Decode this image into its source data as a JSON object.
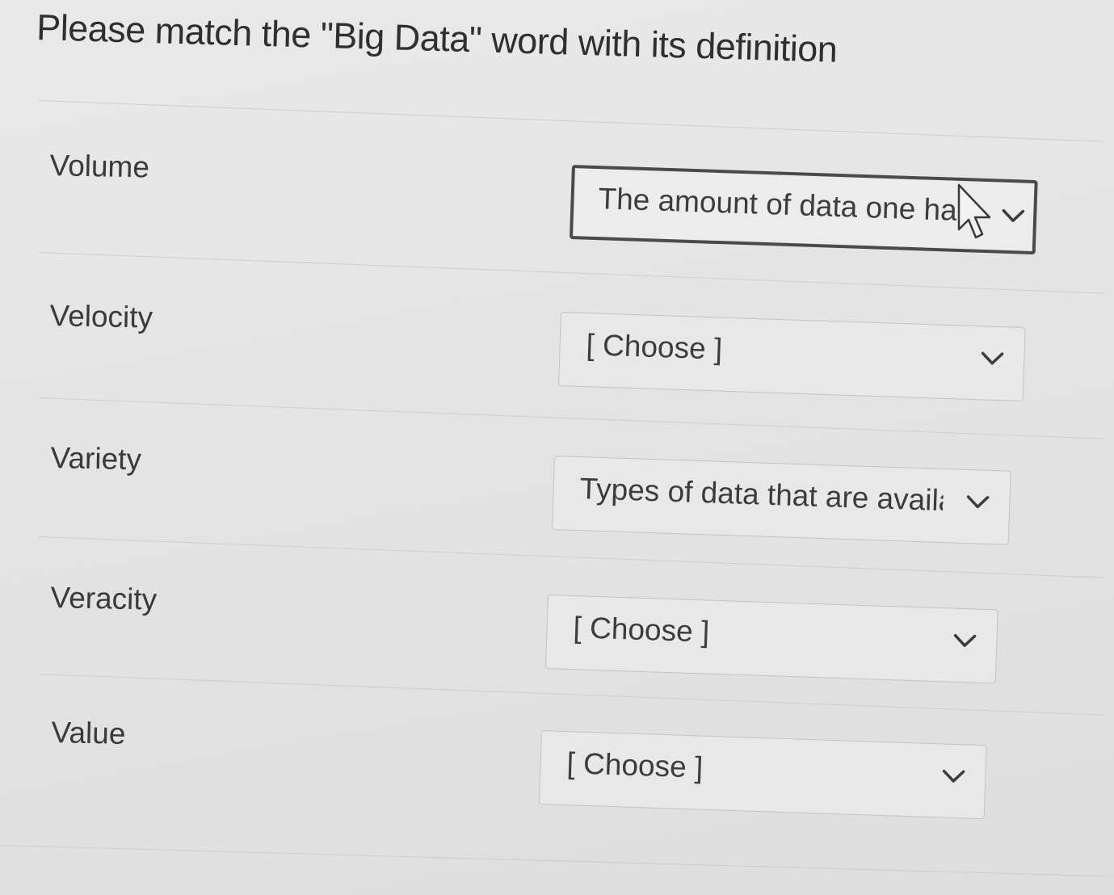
{
  "question": {
    "text": "Please match the \"Big Data\" word with its definition"
  },
  "rows": [
    {
      "term": "Volume",
      "selected": "The amount of data one ha"
    },
    {
      "term": "Velocity",
      "selected": "[ Choose ]"
    },
    {
      "term": "Variety",
      "selected": "Types of data that are availa"
    },
    {
      "term": "Veracity",
      "selected": "[ Choose ]"
    },
    {
      "term": "Value",
      "selected": "[ Choose ]"
    }
  ],
  "icons": {
    "dropdown": "chevron-down-icon",
    "cursor": "mouse-pointer-icon"
  },
  "colors": {
    "background": "#e6e6e6",
    "text": "#3c3c3c",
    "focused_border": "#4a4a4a",
    "border": "#c3c3c3"
  }
}
